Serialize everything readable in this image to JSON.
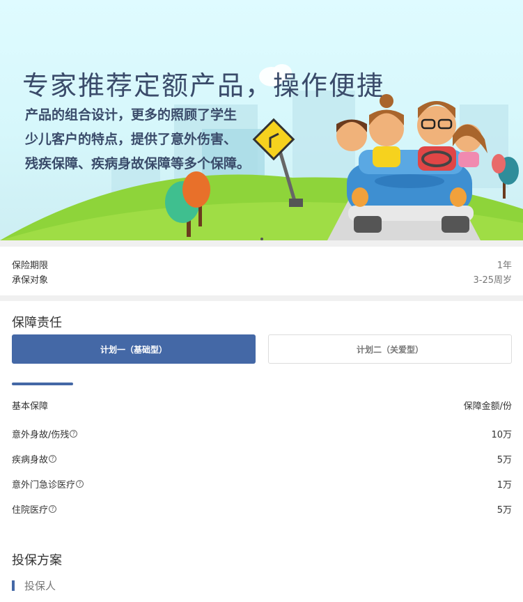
{
  "banner": {
    "headline": "专家推荐定额产品，操作便捷",
    "description_lines": [
      "产品的组合设计，更多的照顾了学生",
      "少儿客户的特点，提供了意外伤害、",
      "残疾保障、疾病身故保障等多个保障。"
    ]
  },
  "info": [
    {
      "label": "保险期限",
      "value": "1年"
    },
    {
      "label": "承保对象",
      "value": "3-25周岁"
    }
  ],
  "coverage": {
    "title": "保障责任",
    "tabs": [
      "计划一（基础型）",
      "计划二（关爱型）"
    ],
    "active_tab": 0,
    "header": {
      "left": "基本保障",
      "right": "保障金额/份"
    },
    "help_glyph": "?",
    "rows": [
      {
        "name": "意外身故/伤残",
        "amount": "10万"
      },
      {
        "name": "疾病身故",
        "amount": "5万"
      },
      {
        "name": "意外门急诊医疗",
        "amount": "1万"
      },
      {
        "name": "住院医疗",
        "amount": "5万"
      }
    ]
  },
  "plan": {
    "title": "投保方案",
    "applicant_label": "投保人"
  },
  "colors": {
    "accent": "#4468a6",
    "banner_sky": "#dffbff",
    "grass": "#8ed43a",
    "car": "#3e8fd1"
  }
}
